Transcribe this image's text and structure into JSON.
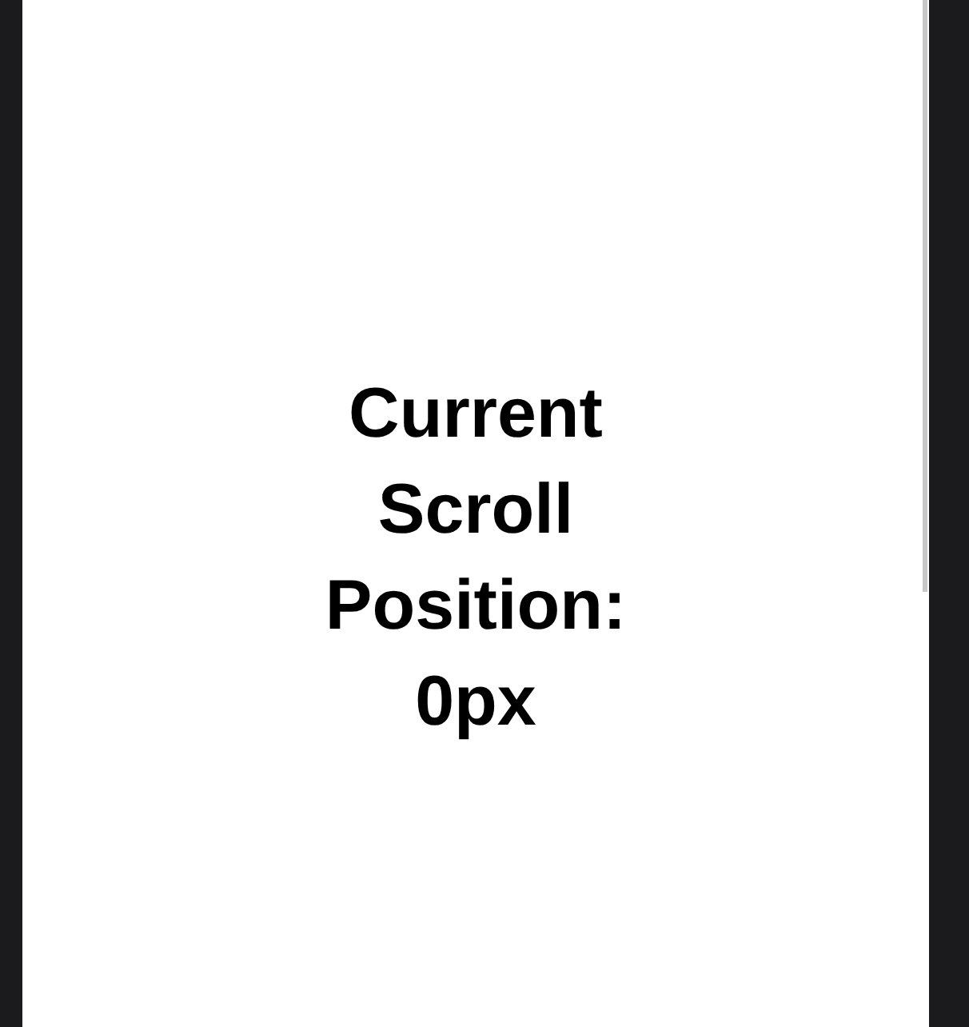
{
  "heading": "Current Scroll Position: 0px"
}
